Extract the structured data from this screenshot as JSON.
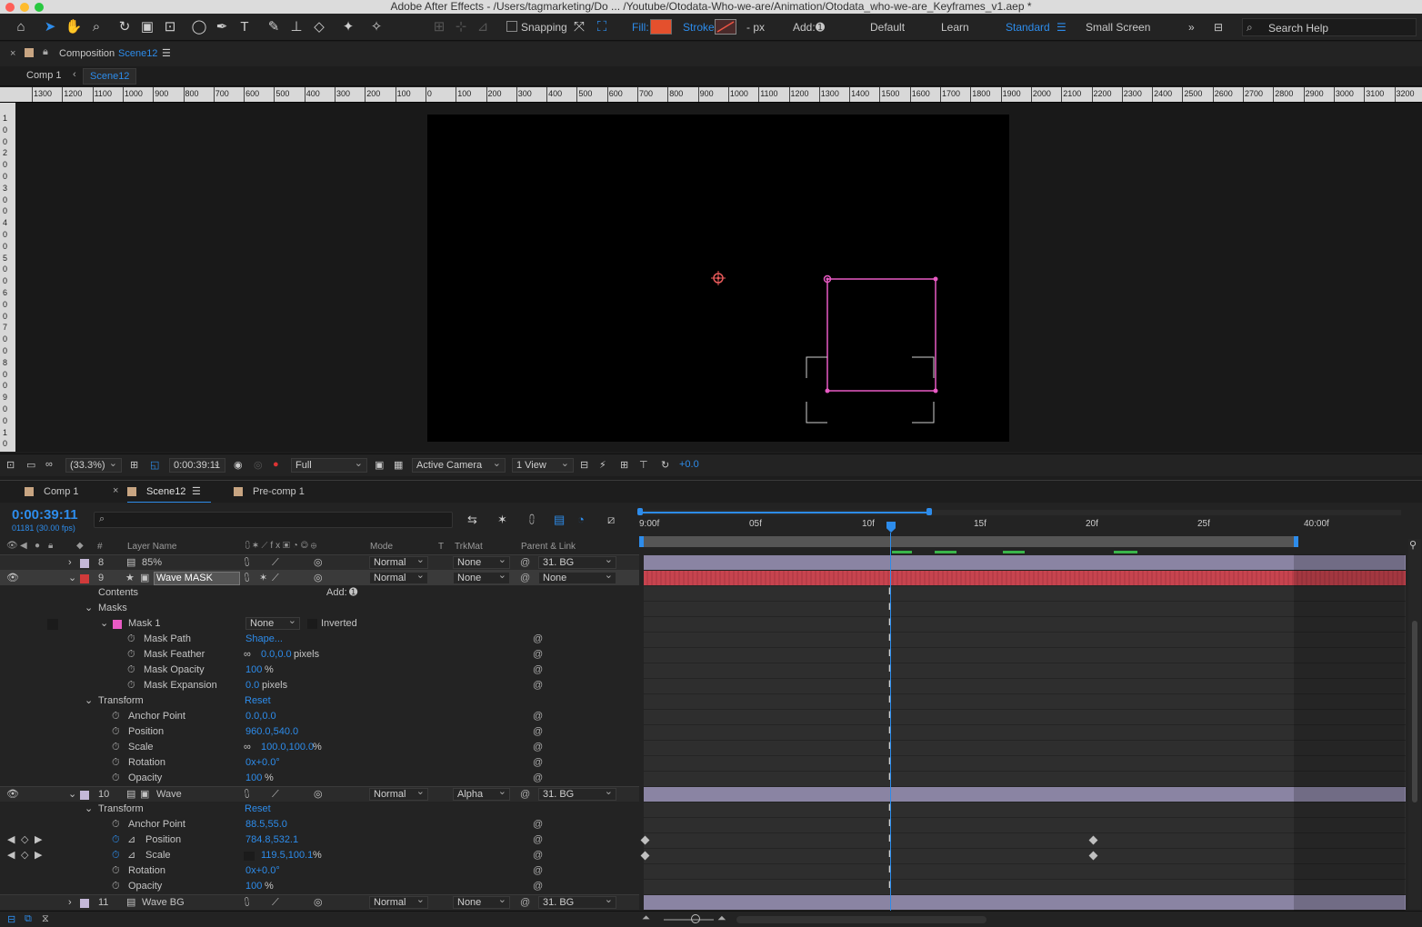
{
  "window": {
    "title": "Adobe After Effects - /Users/tagmarketing/Do ... /Youtube/Otodata-Who-we-are/Animation/Otodata_who-we-are_Keyframes_v1.aep *"
  },
  "toolbar": {
    "snapping_label": "Snapping",
    "fill_label": "Fill:",
    "fill_color": "#e4502d",
    "stroke_label": "Stroke:",
    "stroke_width": "- px",
    "add_label": "Add:",
    "workspaces": [
      "Default",
      "Learn",
      "Standard",
      "Small Screen"
    ],
    "active_workspace": "Standard",
    "search_placeholder": "Search Help"
  },
  "composition_panel": {
    "label": "Composition",
    "name": "Scene12",
    "breadcrumb": [
      "Comp 1",
      "Scene12"
    ]
  },
  "ruler": {
    "h_ticks": [
      "1300",
      "1200",
      "1100",
      "1000",
      "900",
      "800",
      "700",
      "600",
      "500",
      "400",
      "300",
      "200",
      "100",
      "0",
      "100",
      "200",
      "300",
      "400",
      "500",
      "600",
      "700",
      "800",
      "900",
      "1000",
      "1100",
      "1200",
      "1300",
      "1400",
      "1500",
      "1600",
      "1700",
      "1800",
      "1900",
      "2000",
      "2100",
      "2200",
      "2300",
      "2400",
      "2500",
      "2600",
      "2700",
      "2800",
      "2900",
      "3000",
      "3100",
      "3200"
    ],
    "v_ticks": [
      "1",
      "0",
      "0",
      "2",
      "0",
      "0",
      "3",
      "0",
      "0",
      "4",
      "0",
      "0",
      "5",
      "0",
      "0",
      "6",
      "0",
      "0",
      "7",
      "0",
      "0",
      "8",
      "0",
      "0",
      "9",
      "0",
      "0",
      "1",
      "0"
    ]
  },
  "viewer_bar": {
    "zoom": "(33.3%)",
    "timecode": "0:00:39:11",
    "resolution": "Full",
    "camera": "Active Camera",
    "views": "1 View",
    "exposure": "+0.0"
  },
  "timeline_tabs": [
    {
      "label": "Comp 1",
      "color": "#c8a582"
    },
    {
      "label": "Scene12",
      "color": "#c8a582",
      "active": true
    },
    {
      "label": "Pre-comp 1",
      "color": "#c8a582"
    }
  ],
  "timeline": {
    "timecode": "0:00:39:11",
    "frame_fps": "01181 (30.00 fps)",
    "columns": {
      "layer_name": "Layer Name",
      "num": "#",
      "mode": "Mode",
      "t": "T",
      "trkmat": "TrkMat",
      "parent": "Parent & Link"
    },
    "ruler_ticks": [
      "9:00f",
      "05f",
      "10f",
      "15f",
      "20f",
      "25f",
      "40:00f"
    ],
    "add_label": "Add:"
  },
  "layers": {
    "l8": {
      "num": "8",
      "name": "85%",
      "label_color": "#c4b8d8",
      "mode": "Normal",
      "trkmat": "None",
      "parent": "31. BG"
    },
    "l9": {
      "num": "9",
      "name": "Wave MASK",
      "label_color": "#d03a3a",
      "mode": "Normal",
      "trkmat": "None",
      "parent": "None"
    },
    "l10": {
      "num": "10",
      "name": "Wave",
      "label_color": "#c4b8d8",
      "mode": "Normal",
      "trkmat": "Alpha",
      "parent": "31. BG"
    },
    "l11": {
      "num": "11",
      "name": "Wave BG",
      "label_color": "#c4b8d8",
      "mode": "Normal",
      "trkmat": "None",
      "parent": "31. BG"
    }
  },
  "props": {
    "contents": "Contents",
    "masks": "Masks",
    "mask1": "Mask 1",
    "mask1_mode": "None",
    "inverted": "Inverted",
    "mask_path": "Mask Path",
    "mask_path_val": "Shape...",
    "mask_feather": "Mask Feather",
    "mask_feather_val": "0.0,0.0",
    "mask_feather_unit": "pixels",
    "mask_opacity": "Mask Opacity",
    "mask_opacity_val": "100",
    "mask_expansion": "Mask Expansion",
    "mask_expansion_val": "0.0",
    "mask_expansion_unit": "pixels",
    "transform": "Transform",
    "reset": "Reset",
    "anchor": "Anchor Point",
    "anchor9": "0.0,0.0",
    "position": "Position",
    "position9": "960.0,540.0",
    "scale": "Scale",
    "scale9": "100.0,100.0",
    "rotation": "Rotation",
    "rotation9": "0x+0.0°",
    "opacity": "Opacity",
    "opacity9": "100",
    "anchor10": "88.5,55.0",
    "position10": "784.8,532.1",
    "scale10": "119.5,100.1",
    "rotation10": "0x+0.0°",
    "opacity10": "100",
    "pct": "%"
  },
  "colors": {
    "accent": "#2d8ceb",
    "mask_outline": "#e85ac4",
    "layer_bar": "#8a84a3",
    "mask_bar": "#c7444f"
  }
}
